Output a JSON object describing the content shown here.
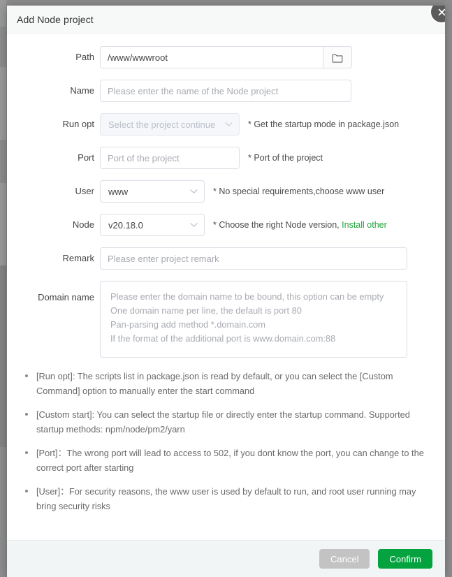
{
  "dialog": {
    "title": "Add Node project",
    "close_icon": "close-icon"
  },
  "form": {
    "path": {
      "label": "Path",
      "value": "/www/wwwroot",
      "browse_icon": "folder-icon"
    },
    "name": {
      "label": "Name",
      "value": "",
      "placeholder": "Please enter the name of the Node project"
    },
    "run_opt": {
      "label": "Run opt",
      "value": "Select the project continue",
      "hint": "* Get the startup mode in package.json",
      "disabled": true
    },
    "port": {
      "label": "Port",
      "value": "",
      "placeholder": "Port of the project",
      "hint": "* Port of the project"
    },
    "user": {
      "label": "User",
      "value": "www",
      "hint": "* No special requirements,choose www user"
    },
    "node": {
      "label": "Node",
      "value": "v20.18.0",
      "hint_prefix": "* Choose the right Node version, ",
      "hint_link": "Install other",
      "link_color": "#20a53a"
    },
    "remark": {
      "label": "Remark",
      "value": "",
      "placeholder": "Please enter project remark"
    },
    "domain_name": {
      "label": "Domain name",
      "value": "",
      "placeholder": "Please enter the domain name to be bound, this option can be empty\nOne domain name per line, the default is port 80\nPan-parsing add method *.domain.com\nIf the format of the additional port is www.domain.com:88"
    }
  },
  "notes": [
    "[Run opt]: The scripts list in package.json is read by default, or you can select the [Custom Command] option to manually enter the start command",
    "[Custom start]: You can select the startup file or directly enter the startup command. Supported startup methods: npm/node/pm2/yarn",
    "[Port]：The wrong port will lead to access to 502, if you dont know the port, you can change to the correct port after starting",
    "[User]：For security reasons, the www user is used by default to run, and root user running may bring security risks"
  ],
  "footer": {
    "cancel_label": "Cancel",
    "confirm_label": "Confirm",
    "confirm_color": "#05a340",
    "cancel_color": "#c3c3c3"
  }
}
